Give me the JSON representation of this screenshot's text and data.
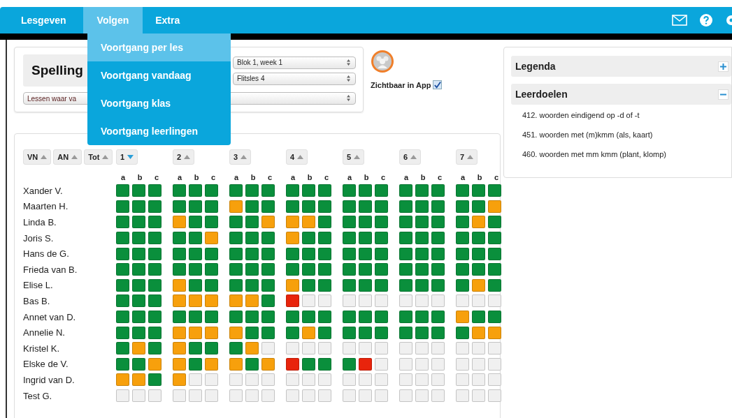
{
  "nav": {
    "items": [
      {
        "label": "Lesgeven",
        "selected": false
      },
      {
        "label": "Volgen",
        "selected": true
      },
      {
        "label": "Extra",
        "selected": false
      }
    ],
    "menu": [
      {
        "label": "Voortgang per les",
        "selected": true
      },
      {
        "label": "Voortgang vandaag",
        "selected": false
      },
      {
        "label": "Voortgang klas",
        "selected": false
      },
      {
        "label": "Voortgang leerlingen",
        "selected": false
      }
    ]
  },
  "course": {
    "title": "Spelling",
    "week": "Blok 1, week 1",
    "lesson": "Flitsles 4",
    "filter": "Lessen waar va",
    "visible_label": "Zichtbaar in App",
    "visible_in_app": true
  },
  "grid": {
    "sort_buttons": [
      {
        "label": "VN",
        "active": false
      },
      {
        "label": "AN",
        "active": false
      },
      {
        "label": "Tot",
        "active": false
      }
    ],
    "lessons": [
      {
        "label": "1",
        "active": true,
        "parts": [
          "a",
          "b",
          "c"
        ]
      },
      {
        "label": "2",
        "active": false,
        "parts": [
          "a",
          "b",
          "c"
        ]
      },
      {
        "label": "3",
        "active": false,
        "parts": [
          "a",
          "b",
          "c"
        ]
      },
      {
        "label": "4",
        "active": false,
        "parts": [
          "a",
          "b",
          "c"
        ]
      },
      {
        "label": "5",
        "active": false,
        "parts": [
          "a",
          "b",
          "c"
        ]
      },
      {
        "label": "6",
        "active": false,
        "parts": [
          "a",
          "b",
          "c"
        ]
      },
      {
        "label": "7",
        "active": false,
        "parts": [
          "a",
          "b",
          "c"
        ]
      }
    ],
    "students": [
      {
        "name": "Xander V.",
        "cells": [
          {
            "color": "#0a8f3c"
          },
          {
            "color": "#0a8f3c"
          },
          {
            "color": "#0a8f3c"
          },
          {
            "color": "#0a8f3c"
          },
          {
            "color": "#0a8f3c"
          },
          {
            "color": "#0a8f3c"
          },
          {
            "color": "#0a8f3c"
          },
          {
            "color": "#0a8f3c"
          },
          {
            "color": "#0a8f3c"
          },
          {
            "color": "#0a8f3c"
          },
          {
            "color": "#0a8f3c"
          },
          {
            "color": "#0a8f3c"
          },
          {
            "color": "#0a8f3c"
          },
          {
            "color": "#0a8f3c"
          },
          {
            "color": "#0a8f3c"
          },
          {
            "color": "#0a8f3c"
          },
          {
            "color": "#0a8f3c"
          },
          {
            "color": "#0a8f3c"
          },
          {
            "color": "#0a8f3c"
          },
          {
            "color": "#0a8f3c"
          },
          {
            "color": "#0a8f3c"
          }
        ]
      },
      {
        "name": "Maarten H.",
        "cells": [
          {
            "color": "#0a8f3c"
          },
          {
            "color": "#0a8f3c"
          },
          {
            "color": "#0a8f3c"
          },
          {
            "color": "#0a8f3c"
          },
          {
            "color": "#0a8f3c"
          },
          {
            "color": "#0a8f3c"
          },
          {
            "color": "#f7a00c"
          },
          {
            "color": "#0a8f3c"
          },
          {
            "color": "#0a8f3c"
          },
          {
            "color": "#0a8f3c"
          },
          {
            "color": "#0a8f3c"
          },
          {
            "color": "#0a8f3c"
          },
          {
            "color": "#0a8f3c"
          },
          {
            "color": "#0a8f3c"
          },
          {
            "color": "#0a8f3c"
          },
          {
            "color": "#0a8f3c"
          },
          {
            "color": "#0a8f3c"
          },
          {
            "color": "#0a8f3c"
          },
          {
            "color": "#0a8f3c"
          },
          {
            "color": "#0a8f3c"
          },
          {
            "color": "#f7a00c"
          }
        ]
      },
      {
        "name": "Linda B.",
        "cells": [
          {
            "color": "#0a8f3c"
          },
          {
            "color": "#0a8f3c"
          },
          {
            "color": "#0a8f3c"
          },
          {
            "color": "#f7a00c"
          },
          {
            "color": "#0a8f3c"
          },
          {
            "color": "#0a8f3c"
          },
          {
            "color": "#0a8f3c"
          },
          {
            "color": "#0a8f3c"
          },
          {
            "color": "#f7a00c"
          },
          {
            "color": "#f7a00c"
          },
          {
            "color": "#f7a00c"
          },
          {
            "color": "#0a8f3c"
          },
          {
            "color": "#0a8f3c"
          },
          {
            "color": "#0a8f3c"
          },
          {
            "color": "#0a8f3c"
          },
          {
            "color": "#0a8f3c"
          },
          {
            "color": "#0a8f3c"
          },
          {
            "color": "#0a8f3c"
          },
          {
            "color": "#0a8f3c"
          },
          {
            "color": "#f7a00c"
          },
          {
            "color": "#0a8f3c"
          }
        ]
      },
      {
        "name": "Joris S.",
        "cells": [
          {
            "color": "#0a8f3c"
          },
          {
            "color": "#0a8f3c"
          },
          {
            "color": "#0a8f3c"
          },
          {
            "color": "#0a8f3c"
          },
          {
            "color": "#0a8f3c"
          },
          {
            "color": "#f7a00c"
          },
          {
            "color": "#0a8f3c"
          },
          {
            "color": "#0a8f3c"
          },
          {
            "color": "#0a8f3c"
          },
          {
            "color": "#f7a00c"
          },
          {
            "color": "#0a8f3c"
          },
          {
            "color": "#0a8f3c"
          },
          {
            "color": "#0a8f3c"
          },
          {
            "color": "#0a8f3c"
          },
          {
            "color": "#0a8f3c"
          },
          {
            "color": "#0a8f3c"
          },
          {
            "color": "#0a8f3c"
          },
          {
            "color": "#0a8f3c"
          },
          {
            "color": "#0a8f3c"
          },
          {
            "color": "#0a8f3c"
          },
          {
            "color": "#0a8f3c"
          }
        ]
      },
      {
        "name": "Hans de G.",
        "cells": [
          {
            "color": "#0a8f3c"
          },
          {
            "color": "#0a8f3c"
          },
          {
            "color": "#0a8f3c"
          },
          {
            "color": "#0a8f3c"
          },
          {
            "color": "#0a8f3c"
          },
          {
            "color": "#0a8f3c"
          },
          {
            "color": "#0a8f3c"
          },
          {
            "color": "#0a8f3c"
          },
          {
            "color": "#0a8f3c"
          },
          {
            "color": "#0a8f3c"
          },
          {
            "color": "#0a8f3c"
          },
          {
            "color": "#0a8f3c"
          },
          {
            "color": "#0a8f3c"
          },
          {
            "color": "#0a8f3c"
          },
          {
            "color": "#0a8f3c"
          },
          {
            "color": "#0a8f3c"
          },
          {
            "color": "#0a8f3c"
          },
          {
            "color": "#0a8f3c"
          },
          {
            "color": "#0a8f3c"
          },
          {
            "color": "#0a8f3c"
          },
          {
            "color": "#0a8f3c"
          }
        ]
      },
      {
        "name": "Frieda van B.",
        "cells": [
          {
            "color": "#0a8f3c"
          },
          {
            "color": "#0a8f3c"
          },
          {
            "color": "#0a8f3c"
          },
          {
            "color": "#0a8f3c"
          },
          {
            "color": "#0a8f3c"
          },
          {
            "color": "#0a8f3c"
          },
          {
            "color": "#0a8f3c"
          },
          {
            "color": "#0a8f3c"
          },
          {
            "color": "#0a8f3c"
          },
          {
            "color": "#0a8f3c"
          },
          {
            "color": "#0a8f3c"
          },
          {
            "color": "#0a8f3c"
          },
          {
            "color": "#0a8f3c"
          },
          {
            "color": "#0a8f3c"
          },
          {
            "color": "#0a8f3c"
          },
          {
            "color": "#0a8f3c"
          },
          {
            "color": "#0a8f3c"
          },
          {
            "color": "#0a8f3c"
          },
          {
            "color": "#0a8f3c"
          },
          {
            "color": "#0a8f3c"
          },
          {
            "color": "#0a8f3c"
          }
        ]
      },
      {
        "name": "Elise L.",
        "cells": [
          {
            "color": "#0a8f3c"
          },
          {
            "color": "#0a8f3c"
          },
          {
            "color": "#0a8f3c"
          },
          {
            "color": "#f7a00c"
          },
          {
            "color": "#0a8f3c"
          },
          {
            "color": "#0a8f3c"
          },
          {
            "color": "#0a8f3c"
          },
          {
            "color": "#0a8f3c"
          },
          {
            "color": "#0a8f3c"
          },
          {
            "color": "#f7a00c"
          },
          {
            "color": "#0a8f3c"
          },
          {
            "color": "#0a8f3c"
          },
          {
            "color": "#0a8f3c"
          },
          {
            "color": "#0a8f3c"
          },
          {
            "color": "#0a8f3c"
          },
          {
            "color": "#0a8f3c"
          },
          {
            "color": "#0a8f3c"
          },
          {
            "color": "#0a8f3c"
          },
          {
            "color": "#0a8f3c"
          },
          {
            "color": "#f7a00c"
          },
          {
            "color": "#0a8f3c"
          }
        ]
      },
      {
        "name": "Bas B.",
        "cells": [
          {
            "color": "#0a8f3c"
          },
          {
            "color": "#0a8f3c"
          },
          {
            "color": "#0a8f3c"
          },
          {
            "color": "#f7a00c"
          },
          {
            "color": "#f7a00c"
          },
          {
            "color": "#f7a00c"
          },
          {
            "color": "#f7a00c"
          },
          {
            "color": "#f7a00c"
          },
          {
            "color": "#0a8f3c"
          },
          {
            "color": "#e8240c"
          },
          {
            "color": "#f0f0f0"
          },
          {
            "color": "#f0f0f0"
          },
          {
            "color": "#f0f0f0"
          },
          {
            "color": "#f0f0f0"
          },
          {
            "color": "#f0f0f0"
          },
          {
            "color": "#f0f0f0"
          },
          {
            "color": "#f0f0f0"
          },
          {
            "color": "#f0f0f0"
          },
          {
            "color": "#f0f0f0"
          },
          {
            "color": "#f0f0f0"
          },
          {
            "color": "#f0f0f0"
          }
        ]
      },
      {
        "name": "Annet van D.",
        "cells": [
          {
            "color": "#0a8f3c"
          },
          {
            "color": "#0a8f3c"
          },
          {
            "color": "#0a8f3c"
          },
          {
            "color": "#0a8f3c"
          },
          {
            "color": "#0a8f3c"
          },
          {
            "color": "#0a8f3c"
          },
          {
            "color": "#0a8f3c"
          },
          {
            "color": "#0a8f3c"
          },
          {
            "color": "#0a8f3c"
          },
          {
            "color": "#0a8f3c"
          },
          {
            "color": "#0a8f3c"
          },
          {
            "color": "#0a8f3c"
          },
          {
            "color": "#0a8f3c"
          },
          {
            "color": "#0a8f3c"
          },
          {
            "color": "#0a8f3c"
          },
          {
            "color": "#0a8f3c"
          },
          {
            "color": "#0a8f3c"
          },
          {
            "color": "#0a8f3c"
          },
          {
            "color": "#f7a00c"
          },
          {
            "color": "#0a8f3c"
          },
          {
            "color": "#0a8f3c"
          }
        ]
      },
      {
        "name": "Annelie N.",
        "cells": [
          {
            "color": "#0a8f3c"
          },
          {
            "color": "#0a8f3c"
          },
          {
            "color": "#0a8f3c"
          },
          {
            "color": "#f7a00c"
          },
          {
            "color": "#f7a00c"
          },
          {
            "color": "#f7a00c"
          },
          {
            "color": "#f7a00c"
          },
          {
            "color": "#0a8f3c"
          },
          {
            "color": "#0a8f3c"
          },
          {
            "color": "#0a8f3c"
          },
          {
            "color": "#f7a00c"
          },
          {
            "color": "#0a8f3c"
          },
          {
            "color": "#0a8f3c"
          },
          {
            "color": "#0a8f3c"
          },
          {
            "color": "#0a8f3c"
          },
          {
            "color": "#0a8f3c"
          },
          {
            "color": "#0a8f3c"
          },
          {
            "color": "#0a8f3c"
          },
          {
            "color": "#0a8f3c"
          },
          {
            "color": "#f7a00c"
          },
          {
            "color": "#f7a00c"
          }
        ]
      },
      {
        "name": "Kristel K.",
        "cells": [
          {
            "color": "#0a8f3c"
          },
          {
            "color": "#f7a00c"
          },
          {
            "color": "#0a8f3c"
          },
          {
            "color": "#f7a00c"
          },
          {
            "color": "#0a8f3c"
          },
          {
            "color": "#0a8f3c"
          },
          {
            "color": "#0a8f3c"
          },
          {
            "color": "#f7a00c"
          },
          {
            "color": "#f0f0f0"
          },
          {
            "color": "#f0f0f0"
          },
          {
            "color": "#f0f0f0"
          },
          {
            "color": "#f0f0f0"
          },
          {
            "color": "#f0f0f0"
          },
          {
            "color": "#f0f0f0"
          },
          {
            "color": "#f0f0f0"
          },
          {
            "color": "#f0f0f0"
          },
          {
            "color": "#f0f0f0"
          },
          {
            "color": "#f0f0f0"
          },
          {
            "color": "#f0f0f0"
          },
          {
            "color": "#f0f0f0"
          },
          {
            "color": "#f0f0f0"
          }
        ]
      },
      {
        "name": "Elske de V.",
        "cells": [
          {
            "color": "#0a8f3c"
          },
          {
            "color": "#0a8f3c"
          },
          {
            "color": "#f7a00c"
          },
          {
            "color": "#f7a00c"
          },
          {
            "color": "#0a8f3c"
          },
          {
            "color": "#f7a00c"
          },
          {
            "color": "#f7a00c"
          },
          {
            "color": "#0a8f3c"
          },
          {
            "color": "#f7a00c"
          },
          {
            "color": "#e8240c"
          },
          {
            "color": "#0a8f3c"
          },
          {
            "color": "#0a8f3c"
          },
          {
            "color": "#0a8f3c"
          },
          {
            "color": "#e8240c"
          },
          {
            "color": "#f0f0f0"
          },
          {
            "color": "#f0f0f0"
          },
          {
            "color": "#f0f0f0"
          },
          {
            "color": "#f0f0f0"
          },
          {
            "color": "#f0f0f0"
          },
          {
            "color": "#f0f0f0"
          },
          {
            "color": "#f0f0f0"
          }
        ]
      },
      {
        "name": "Ingrid van D.",
        "cells": [
          {
            "color": "#f7a00c"
          },
          {
            "color": "#f7a00c"
          },
          {
            "color": "#0a8f3c"
          },
          {
            "color": "#f7a00c"
          },
          {
            "color": "#f0f0f0"
          },
          {
            "color": "#f0f0f0"
          },
          {
            "color": "#f0f0f0"
          },
          {
            "color": "#f0f0f0"
          },
          {
            "color": "#f0f0f0"
          },
          {
            "color": "#f0f0f0"
          },
          {
            "color": "#f0f0f0"
          },
          {
            "color": "#f0f0f0"
          },
          {
            "color": "#f0f0f0"
          },
          {
            "color": "#f0f0f0"
          },
          {
            "color": "#f0f0f0"
          },
          {
            "color": "#f0f0f0"
          },
          {
            "color": "#f0f0f0"
          },
          {
            "color": "#f0f0f0"
          },
          {
            "color": "#f0f0f0"
          },
          {
            "color": "#f0f0f0"
          },
          {
            "color": "#f0f0f0"
          }
        ]
      },
      {
        "name": "Test G.",
        "cells": [
          {
            "color": "#f0f0f0"
          },
          {
            "color": "#f0f0f0"
          },
          {
            "color": "#f0f0f0"
          },
          {
            "color": "#f0f0f0"
          },
          {
            "color": "#f0f0f0"
          },
          {
            "color": "#f0f0f0"
          },
          {
            "color": "#f0f0f0"
          },
          {
            "color": "#f0f0f0"
          },
          {
            "color": "#f0f0f0"
          },
          {
            "color": "#f0f0f0"
          },
          {
            "color": "#f0f0f0"
          },
          {
            "color": "#f0f0f0"
          },
          {
            "color": "#f0f0f0"
          },
          {
            "color": "#f0f0f0"
          },
          {
            "color": "#f0f0f0"
          },
          {
            "color": "#f0f0f0"
          },
          {
            "color": "#f0f0f0"
          },
          {
            "color": "#f0f0f0"
          },
          {
            "color": "#f0f0f0"
          },
          {
            "color": "#f0f0f0"
          },
          {
            "color": "#f0f0f0"
          }
        ]
      }
    ]
  },
  "side": {
    "sections": [
      {
        "title": "Legenda",
        "expanded": false
      },
      {
        "title": "Leerdoelen",
        "expanded": true,
        "items": [
          "412. woorden eindigend op -d of -t",
          "451. woorden met (m)kmm (als, kaart)",
          "460. woorden met mm kmm (plant, klomp)"
        ]
      }
    ]
  }
}
